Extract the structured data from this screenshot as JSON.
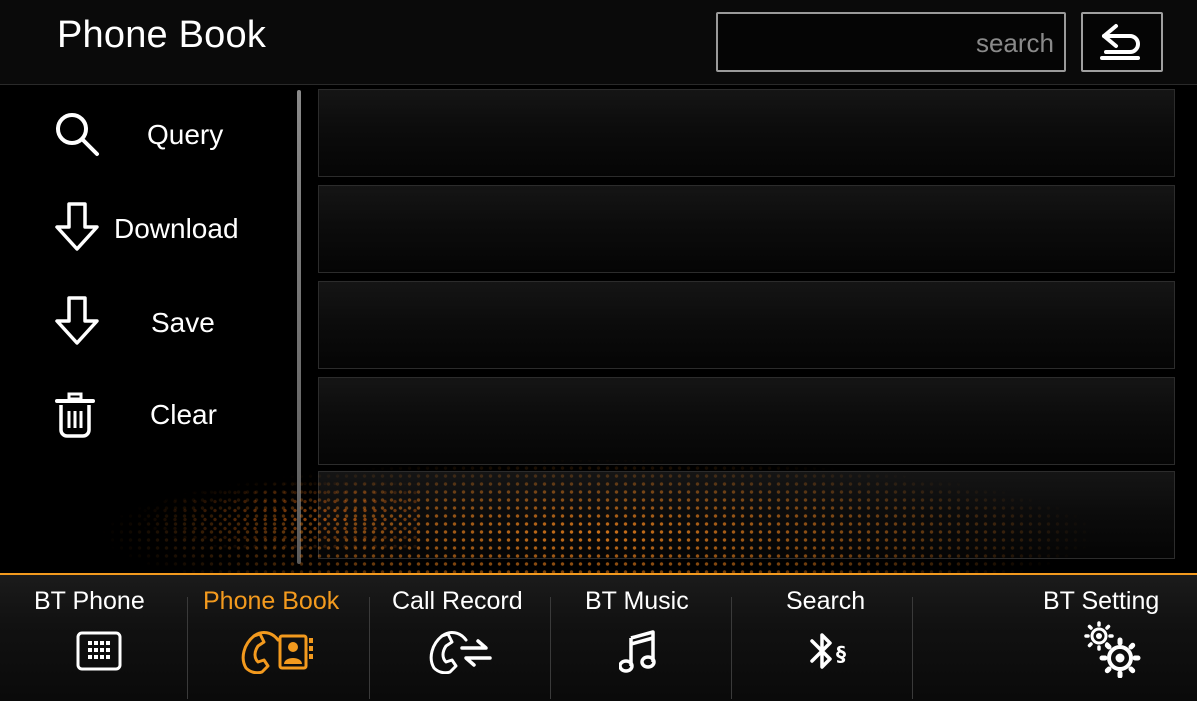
{
  "header": {
    "title": "Phone Book",
    "search_placeholder": "search",
    "back_icon": "back-arrow-icon"
  },
  "sidebar": {
    "items": [
      {
        "label": "Query",
        "icon": "magnifier-icon"
      },
      {
        "label": "Download",
        "icon": "download-arrow-icon"
      },
      {
        "label": "Save",
        "icon": "save-arrow-icon"
      },
      {
        "label": "Clear",
        "icon": "trash-icon"
      }
    ]
  },
  "contacts": {
    "rows": [
      "",
      "",
      "",
      "",
      ""
    ]
  },
  "bottom_nav": {
    "tabs": [
      {
        "label": "BT Phone",
        "icon": "dialpad-icon",
        "active": false
      },
      {
        "label": "Phone Book",
        "icon": "phonebook-icon",
        "active": true
      },
      {
        "label": "Call Record",
        "icon": "call-record-icon",
        "active": false
      },
      {
        "label": "BT Music",
        "icon": "music-note-icon",
        "active": false
      },
      {
        "label": "Search",
        "icon": "bluetooth-search-icon",
        "active": false
      },
      {
        "label": "BT Setting",
        "icon": "gears-icon",
        "active": false
      }
    ]
  },
  "colors": {
    "accent": "#f39a1e",
    "background": "#000000",
    "text": "#ffffff"
  }
}
